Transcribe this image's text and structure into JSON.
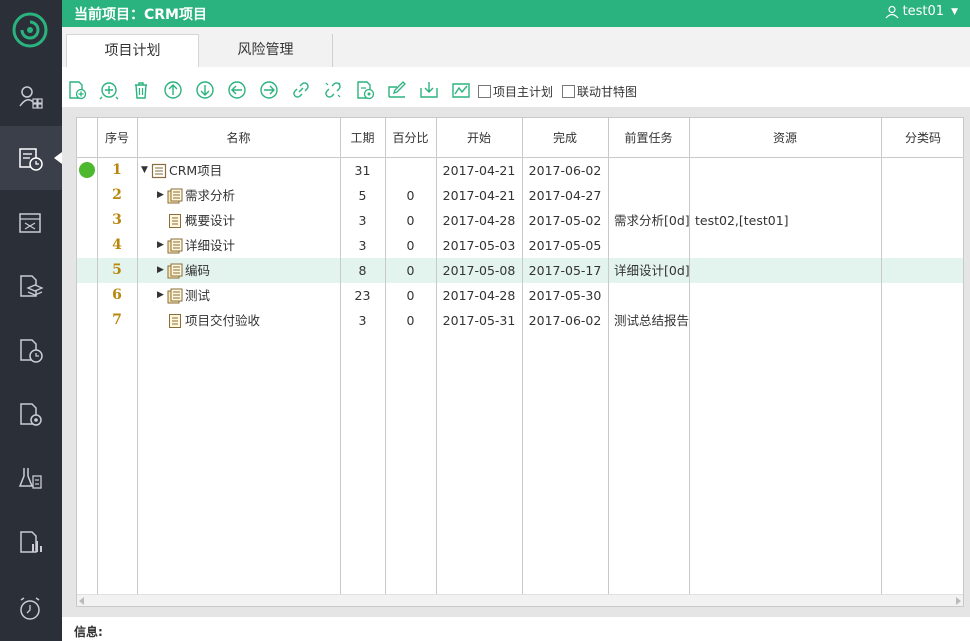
{
  "header": {
    "title": "当前项目：CRM项目",
    "user": "test01"
  },
  "tabs": [
    {
      "label": "项目计划",
      "active": true
    },
    {
      "label": "风险管理",
      "active": false
    }
  ],
  "toolbar": {
    "icons": [
      "add-task-icon",
      "add-subtask-icon",
      "delete-icon",
      "move-up-icon",
      "move-down-icon",
      "outdent-icon",
      "indent-icon",
      "link-icon",
      "unlink-icon",
      "task-info-icon",
      "edit-icon",
      "import-icon",
      "chart-icon"
    ],
    "checkbox_main_plan": "项目主计划",
    "checkbox_gantt": "联动甘特图"
  },
  "table": {
    "columns": [
      "序号",
      "名称",
      "工期",
      "百分比",
      "开始",
      "完成",
      "前置任务",
      "资源",
      "分类码"
    ],
    "rows": [
      {
        "num": "1",
        "name": "CRM项目",
        "duration": "31",
        "percent": "",
        "start": "2017-04-21",
        "finish": "2017-06-02",
        "pred": "",
        "resource": "",
        "code": "",
        "level": 0,
        "expander": "▼",
        "icon": "project-icon",
        "status": true
      },
      {
        "num": "2",
        "name": "需求分析",
        "duration": "5",
        "percent": "0",
        "start": "2017-04-21",
        "finish": "2017-04-27",
        "pred": "",
        "resource": "",
        "code": "",
        "level": 1,
        "expander": "▶",
        "icon": "summary-task-icon"
      },
      {
        "num": "3",
        "name": "概要设计",
        "duration": "3",
        "percent": "0",
        "start": "2017-04-28",
        "finish": "2017-05-02",
        "pred": "需求分析[0d]",
        "resource": "test02,[test01]",
        "code": "",
        "level": 1,
        "expander": "",
        "icon": "task-icon"
      },
      {
        "num": "4",
        "name": "详细设计",
        "duration": "3",
        "percent": "0",
        "start": "2017-05-03",
        "finish": "2017-05-05",
        "pred": "",
        "resource": "",
        "code": "",
        "level": 1,
        "expander": "▶",
        "icon": "summary-task-icon"
      },
      {
        "num": "5",
        "name": "编码",
        "duration": "8",
        "percent": "0",
        "start": "2017-05-08",
        "finish": "2017-05-17",
        "pred": "详细设计[0d]",
        "resource": "",
        "code": "",
        "level": 1,
        "expander": "▶",
        "icon": "summary-task-icon",
        "selected": true
      },
      {
        "num": "6",
        "name": "测试",
        "duration": "23",
        "percent": "0",
        "start": "2017-04-28",
        "finish": "2017-05-30",
        "pred": "",
        "resource": "",
        "code": "",
        "level": 1,
        "expander": "▶",
        "icon": "summary-task-icon"
      },
      {
        "num": "7",
        "name": "项目交付验收",
        "duration": "3",
        "percent": "0",
        "start": "2017-05-31",
        "finish": "2017-06-02",
        "pred": "测试总结报告",
        "resource": "",
        "code": "",
        "level": 1,
        "expander": "",
        "icon": "task-icon"
      }
    ]
  },
  "footer": {
    "label": "信息:"
  },
  "colors": {
    "header": "#2ab37e",
    "sidebar": "#2b2f38",
    "selected_row": "#e3f3ed",
    "status_dot": "#4cb82e",
    "icon": "#2ab37e"
  }
}
